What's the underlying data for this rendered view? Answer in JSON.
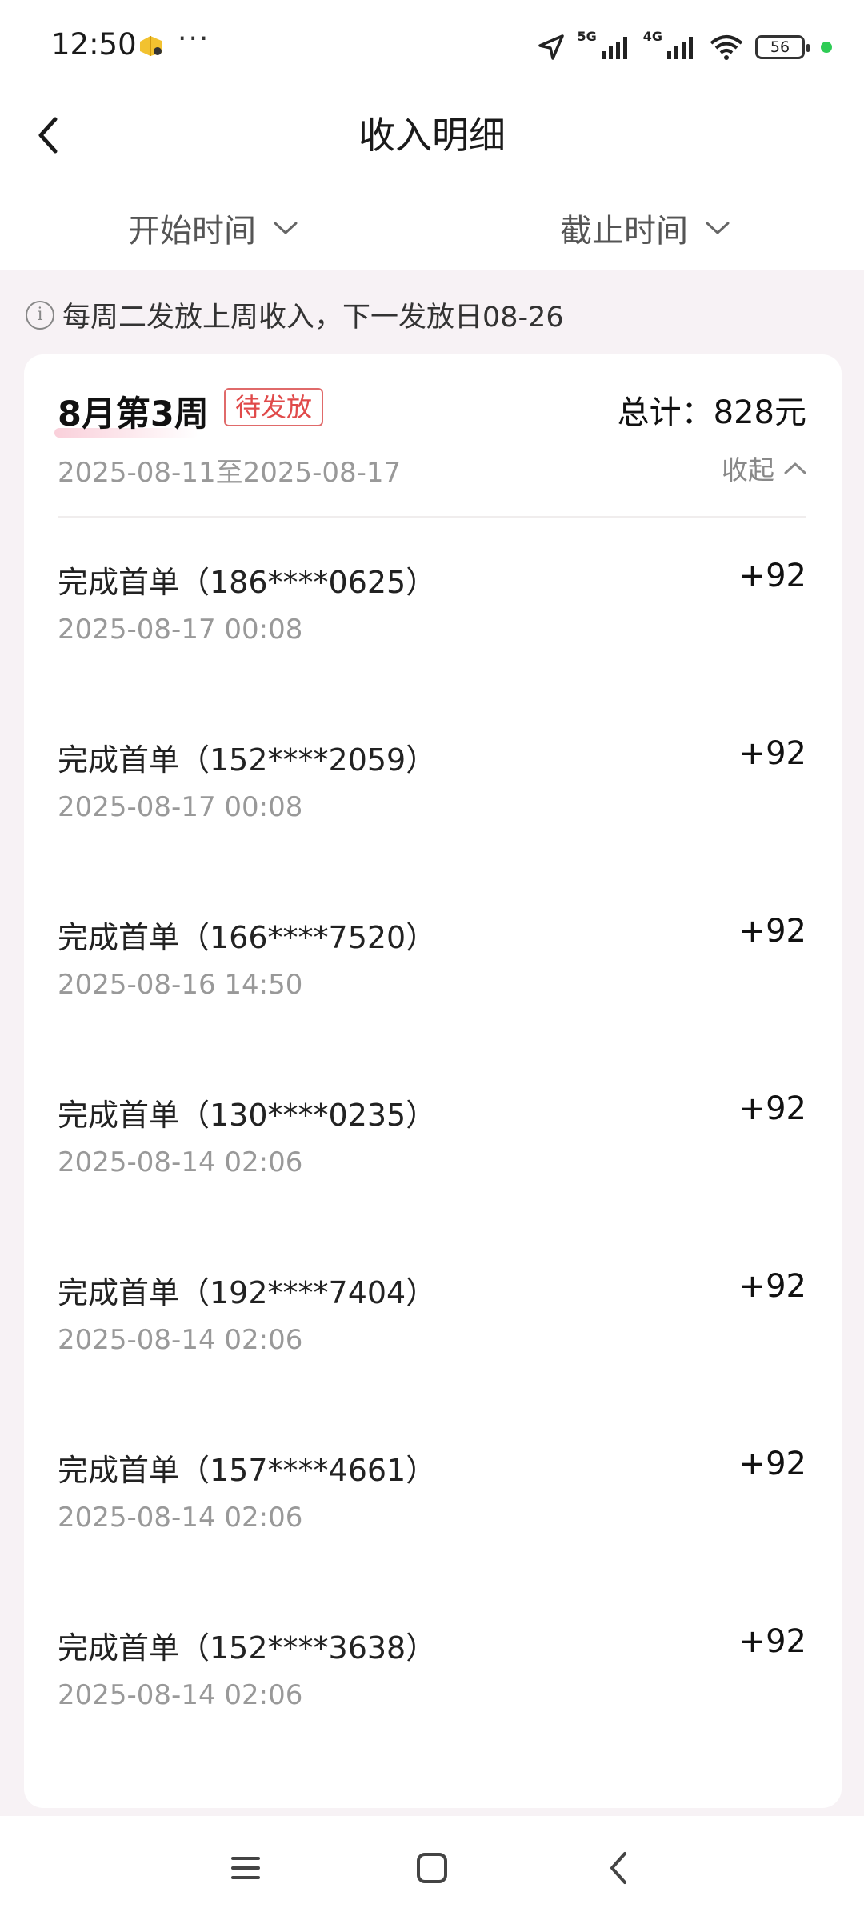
{
  "status_bar": {
    "time": "12:50",
    "more": "···",
    "network_1": "5G",
    "network_2": "4G",
    "battery": "56",
    "icons": [
      "app-notification-icon",
      "location-icon",
      "signal-icon",
      "signal-icon",
      "wifi-icon",
      "battery-icon"
    ]
  },
  "header": {
    "title": "收入明细",
    "back_icon": "chevron-left-icon"
  },
  "filters": {
    "start_label": "开始时间",
    "end_label": "截止时间"
  },
  "notice": {
    "text": "每周二发放上周收入，下一发放日08-26",
    "icon_glyph": "i"
  },
  "week_card": {
    "title": "8月第3周",
    "status": "待发放",
    "total": "总计：828元",
    "range": "2025-08-11至2025-08-17",
    "collapse_label": "收起",
    "items": [
      {
        "title": "完成首单（186****0625）",
        "time": "2025-08-17 00:08",
        "amount": "+92"
      },
      {
        "title": "完成首单（152****2059）",
        "time": "2025-08-17 00:08",
        "amount": "+92"
      },
      {
        "title": "完成首单（166****7520）",
        "time": "2025-08-16 14:50",
        "amount": "+92"
      },
      {
        "title": "完成首单（130****0235）",
        "time": "2025-08-14 02:06",
        "amount": "+92"
      },
      {
        "title": "完成首单（192****7404）",
        "time": "2025-08-14 02:06",
        "amount": "+92"
      },
      {
        "title": "完成首单（157****4661）",
        "time": "2025-08-14 02:06",
        "amount": "+92"
      },
      {
        "title": "完成首单（152****3638）",
        "time": "2025-08-14 02:06",
        "amount": "+92"
      }
    ]
  },
  "colors": {
    "accent_red": "#e04a4a",
    "page_bg": "#f7f2f5",
    "muted_text": "#999999"
  }
}
